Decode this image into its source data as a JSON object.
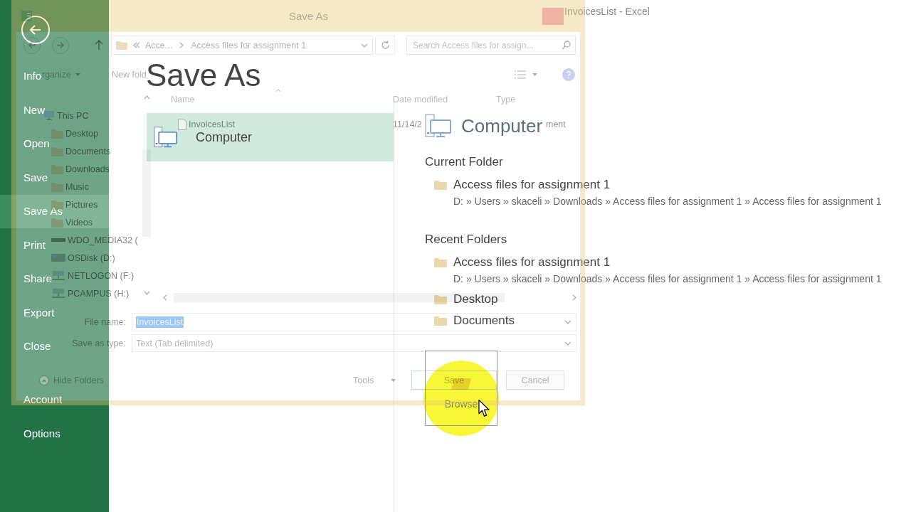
{
  "window": {
    "title": "InvoicesList - Excel"
  },
  "backstage": {
    "menu": [
      {
        "label": "Info",
        "selected": false
      },
      {
        "label": "New",
        "selected": false
      },
      {
        "label": "Open",
        "selected": false
      },
      {
        "label": "Save",
        "selected": false
      },
      {
        "label": "Save As",
        "selected": true
      },
      {
        "label": "Print",
        "selected": false
      },
      {
        "label": "Share",
        "selected": false
      },
      {
        "label": "Export",
        "selected": false
      },
      {
        "label": "Close",
        "selected": false
      }
    ],
    "menu_bottom": [
      {
        "label": "Account",
        "selected": false
      },
      {
        "label": "Options",
        "selected": false
      }
    ],
    "title": "Save As",
    "places": [
      {
        "label": "Computer",
        "selected": true
      }
    ],
    "panel": {
      "heading": "Computer",
      "sections": [
        {
          "heading": "Current Folder",
          "folders": [
            {
              "name": "Access files for assignment 1",
              "path": "D: » Users » skaceli » Downloads » Access files for assignment 1 » Access files for assignment 1"
            }
          ]
        },
        {
          "heading": "Recent Folders",
          "folders": [
            {
              "name": "Access files for assignment 1",
              "path": "D: » Users » skaceli » Downloads » Access files for assignment 1 » Access files for assignment 1"
            },
            {
              "name": "Desktop"
            },
            {
              "name": "Documents"
            }
          ]
        }
      ],
      "browse_button": "Browse"
    }
  },
  "dialog": {
    "title": "Save As",
    "breadcrumbs": [
      "Acce...",
      "Access files for assignment 1"
    ],
    "search": {
      "placeholder": "Search Access files for assign..."
    },
    "toolbar": {
      "organize": "rganize",
      "new_folder": "New fold"
    },
    "tree": [
      {
        "label": "This PC",
        "kind": "computer",
        "children": [
          {
            "label": "Desktop",
            "kind": "folder"
          },
          {
            "label": "Documents",
            "kind": "folder"
          },
          {
            "label": "Downloads",
            "kind": "folder"
          },
          {
            "label": "Music",
            "kind": "folder"
          },
          {
            "label": "Pictures",
            "kind": "folder"
          },
          {
            "label": "Videos",
            "kind": "folder"
          },
          {
            "label": "WDO_MEDIA32 (",
            "kind": "removable-drive"
          },
          {
            "label": "OSDisk (D:)",
            "kind": "drive"
          },
          {
            "label": "NETLOGON (F:)",
            "kind": "network-drive"
          },
          {
            "label": "PCAMPUS (H:)",
            "kind": "network-drive"
          }
        ]
      }
    ],
    "columns": [
      "Name",
      "Date modified",
      "Type"
    ],
    "files": [
      {
        "name": "InvoicesList",
        "date": "11/14/2",
        "type": "ment"
      }
    ],
    "file_name": {
      "label": "File name:",
      "value": "InvoicesList",
      "text_selected": true
    },
    "save_as_type": {
      "label": "Save as type:",
      "value": "Text (Tab delimited)"
    },
    "hide_folders": "Hide Folders",
    "tools": "Tools",
    "buttons": [
      "Save",
      "Cancel"
    ]
  }
}
